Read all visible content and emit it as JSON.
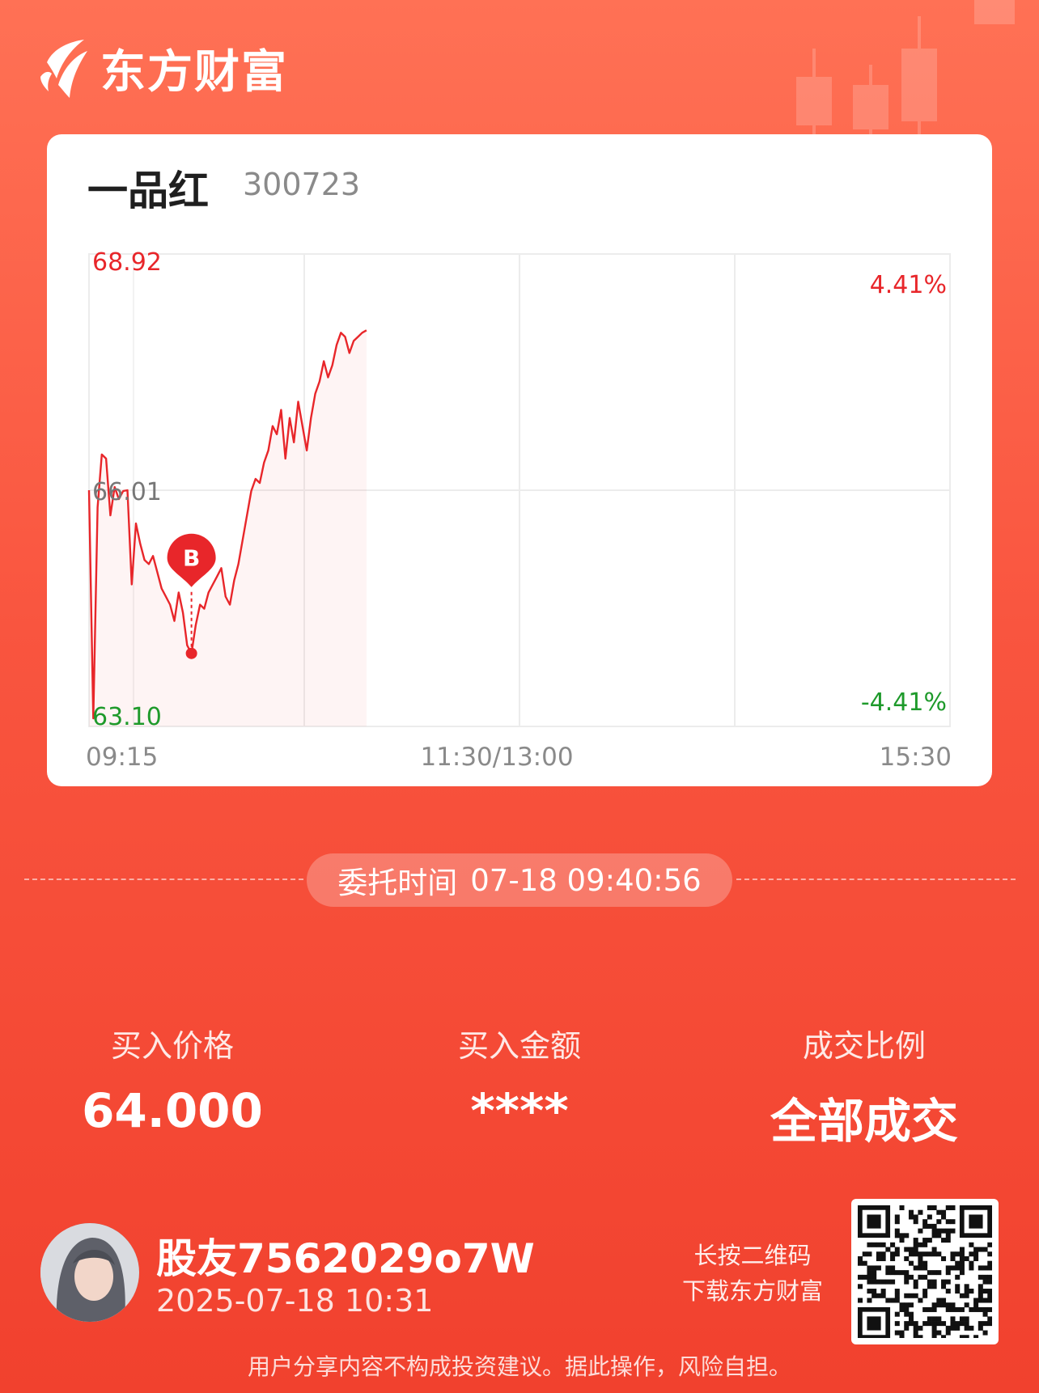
{
  "brand": {
    "name": "东方财富"
  },
  "stock": {
    "name": "一品红",
    "code": "300723"
  },
  "chart_data": {
    "type": "line",
    "y_top_label": "68.92",
    "y_mid_label": "66.01",
    "y_bottom_label": "63.10",
    "pct_top": "4.41%",
    "pct_bottom": "-4.41%",
    "x_labels": [
      "09:15",
      "11:30/13:00",
      "15:30"
    ],
    "ylim": [
      63.1,
      68.92
    ],
    "x_session_minutes": [
      0,
      240
    ],
    "series": [
      {
        "x": [
          0,
          1,
          2,
          3,
          4,
          5,
          6,
          7,
          8,
          9,
          10,
          11,
          12,
          13,
          14,
          15,
          16,
          17,
          18,
          19,
          20,
          21,
          22,
          23,
          24,
          25,
          26,
          27,
          28,
          29,
          30,
          31,
          32,
          33,
          34,
          35,
          36,
          37,
          38,
          39,
          40,
          41,
          42,
          43,
          44,
          45,
          46,
          47,
          48,
          49,
          50,
          51,
          52,
          53,
          54,
          55,
          56,
          57,
          58,
          59,
          60,
          61,
          62,
          63,
          64,
          65
        ],
        "values": [
          66.01,
          63.2,
          65.8,
          66.45,
          66.4,
          65.7,
          66.05,
          65.9,
          66.0,
          66.01,
          64.85,
          65.6,
          65.35,
          65.15,
          65.1,
          65.2,
          65.0,
          64.8,
          64.7,
          64.6,
          64.4,
          64.75,
          64.5,
          64.1,
          64.0,
          64.35,
          64.6,
          64.55,
          64.75,
          64.85,
          64.95,
          65.05,
          64.7,
          64.6,
          64.9,
          65.1,
          65.4,
          65.7,
          66.0,
          66.15,
          66.1,
          66.35,
          66.5,
          66.8,
          66.7,
          67.0,
          66.4,
          66.9,
          66.6,
          67.1,
          66.8,
          66.5,
          66.9,
          67.2,
          67.35,
          67.6,
          67.4,
          67.55,
          67.8,
          67.95,
          67.9,
          67.7,
          67.85,
          67.9,
          67.95,
          67.98
        ]
      }
    ],
    "buy_marker": {
      "label": "B",
      "x": 24,
      "value": 64.0
    }
  },
  "entrust": {
    "label": "委托时间",
    "value": "07-18 09:40:56"
  },
  "stats": [
    {
      "label": "买入价格",
      "value": "64.000"
    },
    {
      "label": "买入金额",
      "value": "****"
    },
    {
      "label": "成交比例",
      "value": "全部成交"
    }
  ],
  "user": {
    "name": "股友7562029o7W",
    "time": "2025-07-18 10:31"
  },
  "qr": {
    "hint_line1": "长按二维码",
    "hint_line2": "下载东方财富"
  },
  "disclaimer": "用户分享内容不构成投资建议。据此操作，风险自担。",
  "colors": {
    "up": "#e8262a",
    "down": "#1e9a2b",
    "background": "#f9553f"
  }
}
